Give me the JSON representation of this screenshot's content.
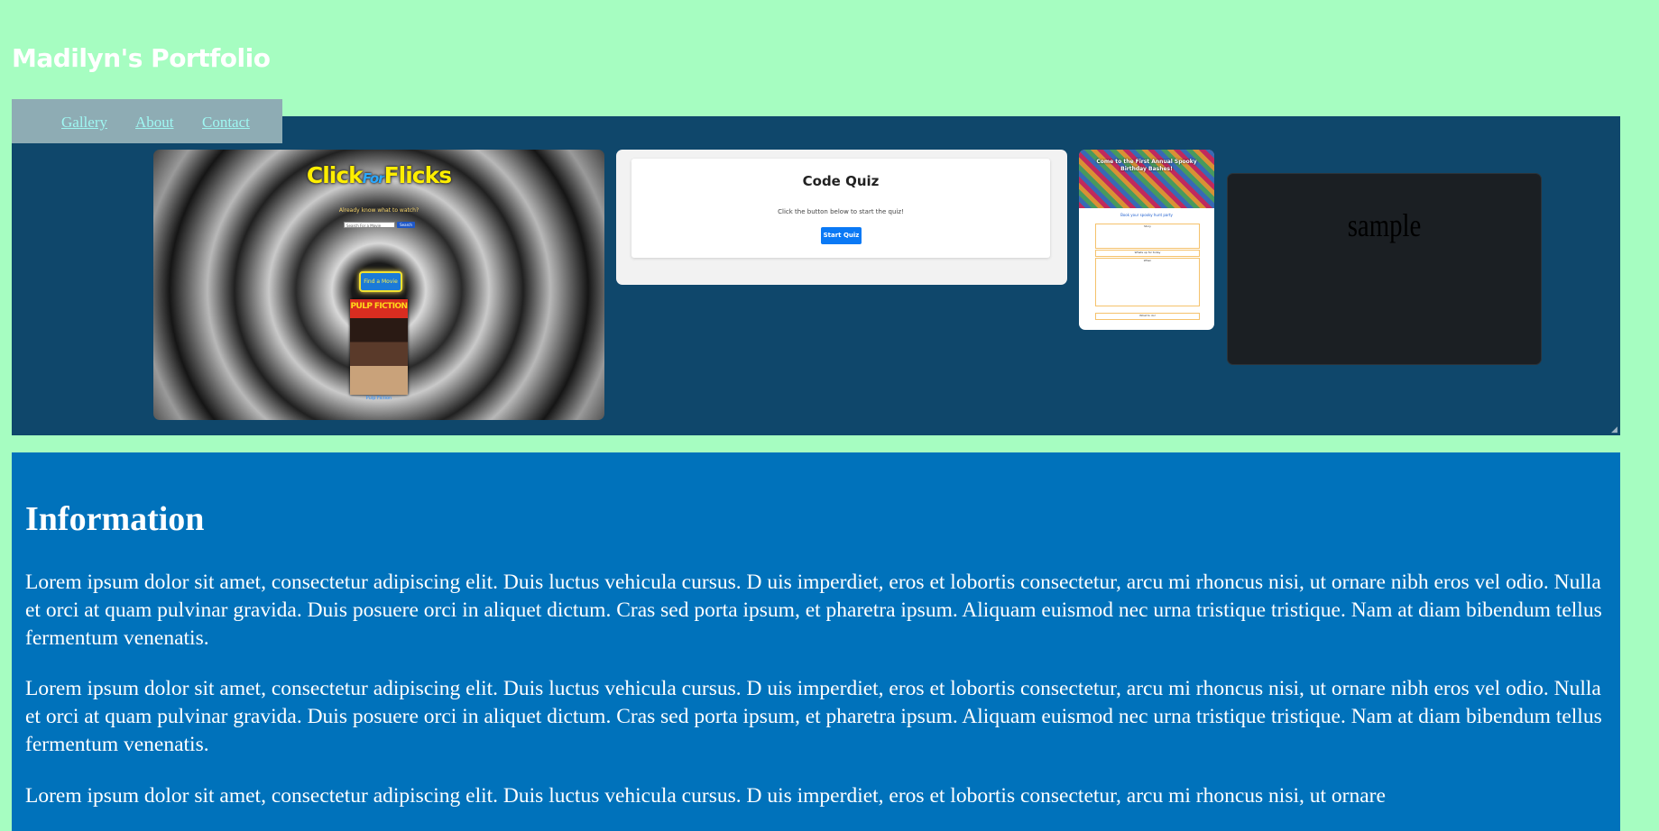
{
  "header": {
    "site_title": "Madilyn's Portfolio"
  },
  "nav": {
    "items": [
      {
        "label": "Gallery"
      },
      {
        "label": "About"
      },
      {
        "label": "Contact"
      }
    ]
  },
  "gallery": {
    "cards": {
      "flicks": {
        "title_click": "Click",
        "title_for": "For",
        "title_flicks": "Flicks",
        "prompt": "Already know what to watch?",
        "search_placeholder": "Search For a Movie",
        "search_button": "Search",
        "find_button": "Find a Movie",
        "poster_title": "PULP FICTION",
        "poster_caption": "Pulp Fiction"
      },
      "quiz": {
        "title": "Code Quiz",
        "text": "Click the button below to start the quiz!",
        "button": "Start Quiz"
      },
      "birthday": {
        "banner": "Come to the First Annual Spooky Birthday Bashes!",
        "subtitle": "Book your spooky hunt party",
        "box1": "Story",
        "box2": "Whats up for today",
        "box3": "When",
        "box4": "What to do!"
      },
      "sample": {
        "text": "sample"
      }
    }
  },
  "info": {
    "heading": "Information",
    "paragraphs": [
      "Lorem ipsum dolor sit amet, consectetur adipiscing elit. Duis luctus vehicula cursus. D uis imperdiet, eros et lobortis consectetur, arcu mi rhoncus nisi, ut ornare nibh eros vel odio. Nulla et orci at quam pulvinar gravida. Duis posuere orci in aliquet dictum. Cras sed porta ipsum, et pharetra ipsum. Aliquam euismod nec urna tristique tristique. Nam at diam bibendum tellus fermentum venenatis.",
      "Lorem ipsum dolor sit amet, consectetur adipiscing elit. Duis luctus vehicula cursus. D uis imperdiet, eros et lobortis consectetur, arcu mi rhoncus nisi, ut ornare nibh eros vel odio. Nulla et orci at quam pulvinar gravida. Duis posuere orci in aliquet dictum. Cras sed porta ipsum, et pharetra ipsum. Aliquam euismod nec urna tristique tristique. Nam at diam bibendum tellus fermentum venenatis.",
      "Lorem ipsum dolor sit amet, consectetur adipiscing elit. Duis luctus vehicula cursus. D uis imperdiet, eros et lobortis consectetur, arcu mi rhoncus nisi, ut ornare"
    ]
  },
  "colors": {
    "page_background": "#a6fdc1",
    "gallery_background": "#0f476b",
    "nav_background": "#8eacb4",
    "nav_link": "#9ff7f2",
    "info_background": "#0072bb"
  }
}
